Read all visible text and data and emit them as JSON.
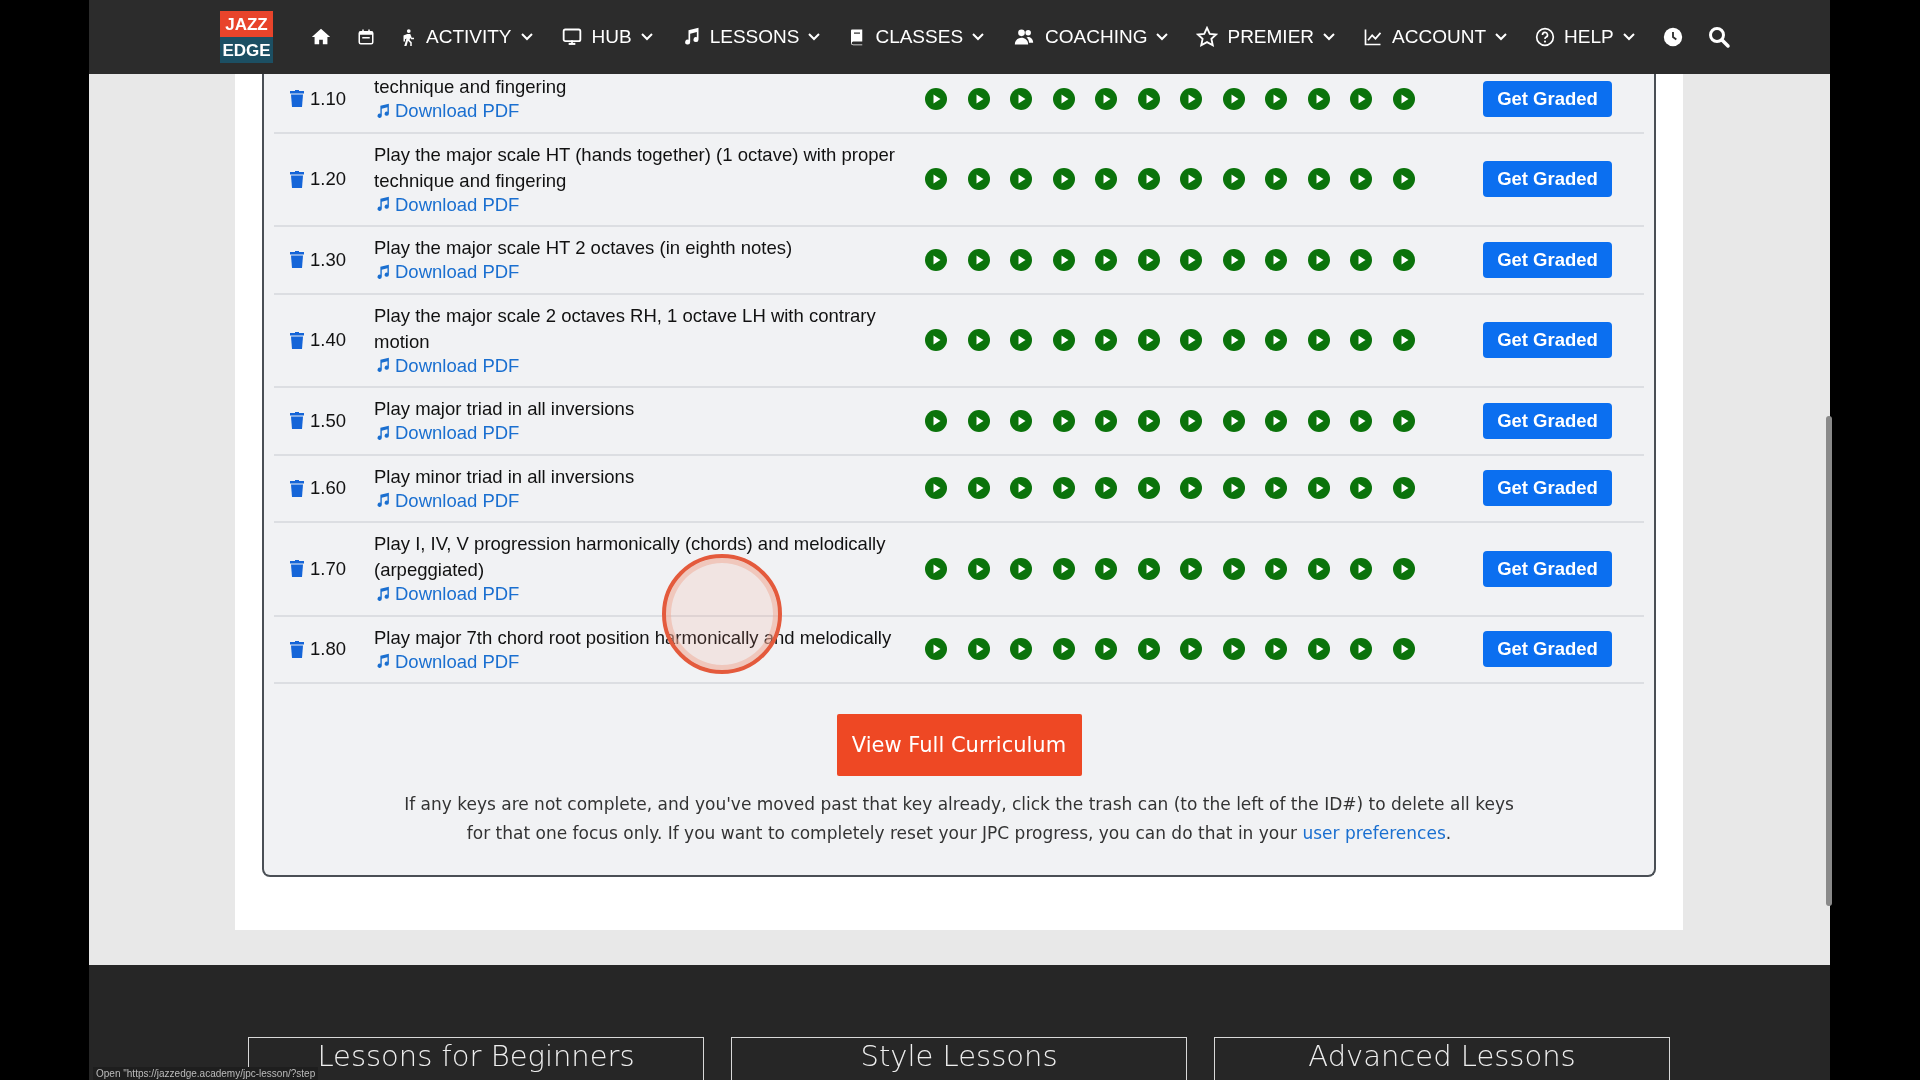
{
  "nav": {
    "items": [
      {
        "kind": "home"
      },
      {
        "kind": "calendar"
      },
      {
        "kind": "activity",
        "label": "ACTIVITY"
      },
      {
        "kind": "hub",
        "label": "HUB"
      },
      {
        "kind": "lessons",
        "label": "LESSONS"
      },
      {
        "kind": "classes",
        "label": "CLASSES"
      },
      {
        "kind": "coaching",
        "label": "COACHING"
      },
      {
        "kind": "premier",
        "label": "PREMIER"
      },
      {
        "kind": "account",
        "label": "ACCOUNT"
      },
      {
        "kind": "help",
        "label": "HELP"
      },
      {
        "kind": "history"
      },
      {
        "kind": "search"
      }
    ],
    "logo": {
      "top": "JAZZ",
      "bottom": "EDGE"
    }
  },
  "curriculum": {
    "rows": [
      {
        "id": "1.10",
        "description": "technique and fingering",
        "download": "Download PDF",
        "keys": [
          {
            "kind": "play"
          },
          {
            "kind": "play"
          },
          {
            "kind": "play"
          },
          {
            "kind": "play"
          },
          {
            "kind": "play"
          },
          {
            "kind": "play"
          },
          {
            "kind": "play"
          },
          {
            "kind": "play"
          },
          {
            "kind": "play"
          },
          {
            "kind": "play"
          },
          {
            "kind": "play"
          },
          {
            "kind": "play"
          }
        ],
        "button": "Get Graded"
      },
      {
        "id": "1.20",
        "description": "Play the major scale HT (hands together) (1 octave) with proper technique and fingering",
        "download": "Download PDF",
        "keys": [
          {
            "kind": "play"
          },
          {
            "kind": "play"
          },
          {
            "kind": "play"
          },
          {
            "kind": "play"
          },
          {
            "kind": "play"
          },
          {
            "kind": "play"
          },
          {
            "kind": "play"
          },
          {
            "kind": "play"
          },
          {
            "kind": "play"
          },
          {
            "kind": "play"
          },
          {
            "kind": "play"
          },
          {
            "kind": "play"
          }
        ],
        "button": "Get Graded"
      },
      {
        "id": "1.30",
        "description": "Play the major scale HT 2 octaves (in eighth notes)",
        "download": "Download PDF",
        "keys": [
          {
            "kind": "play"
          },
          {
            "kind": "play"
          },
          {
            "kind": "play"
          },
          {
            "kind": "play"
          },
          {
            "kind": "play"
          },
          {
            "kind": "play"
          },
          {
            "kind": "play"
          },
          {
            "kind": "play"
          },
          {
            "kind": "play"
          },
          {
            "kind": "play"
          },
          {
            "kind": "play"
          },
          {
            "kind": "play"
          }
        ],
        "button": "Get Graded"
      },
      {
        "id": "1.40",
        "description": "Play the major scale 2 octaves RH, 1 octave LH with contrary motion",
        "download": "Download PDF",
        "keys": [
          {
            "kind": "play"
          },
          {
            "kind": "play"
          },
          {
            "kind": "play"
          },
          {
            "kind": "play"
          },
          {
            "kind": "play"
          },
          {
            "kind": "play"
          },
          {
            "kind": "play"
          },
          {
            "kind": "play"
          },
          {
            "kind": "play"
          },
          {
            "kind": "play"
          },
          {
            "kind": "play"
          },
          {
            "kind": "play"
          }
        ],
        "button": "Get Graded"
      },
      {
        "id": "1.50",
        "description": "Play major triad in all inversions",
        "download": "Download PDF",
        "keys": [
          {
            "kind": "play"
          },
          {
            "kind": "play"
          },
          {
            "kind": "play"
          },
          {
            "kind": "play"
          },
          {
            "kind": "play"
          },
          {
            "kind": "play"
          },
          {
            "kind": "play"
          },
          {
            "kind": "play"
          },
          {
            "kind": "play"
          },
          {
            "kind": "play"
          },
          {
            "kind": "play"
          },
          {
            "kind": "play"
          }
        ],
        "button": "Get Graded"
      },
      {
        "id": "1.60",
        "description": "Play minor triad in all inversions",
        "download": "Download PDF",
        "keys": [
          {
            "kind": "play"
          },
          {
            "kind": "play"
          },
          {
            "kind": "play"
          },
          {
            "kind": "play"
          },
          {
            "kind": "play"
          },
          {
            "kind": "play"
          },
          {
            "kind": "play"
          },
          {
            "kind": "play"
          },
          {
            "kind": "play"
          },
          {
            "kind": "play"
          },
          {
            "kind": "play"
          },
          {
            "kind": "play"
          }
        ],
        "button": "Get Graded"
      },
      {
        "id": "1.70",
        "description": "Play I, IV, V progression harmonically (chords) and melodically (arpeggiated)",
        "download": "Download PDF",
        "keys": [
          {
            "kind": "play"
          },
          {
            "kind": "play"
          },
          {
            "kind": "play"
          },
          {
            "kind": "play"
          },
          {
            "kind": "play"
          },
          {
            "kind": "play"
          },
          {
            "kind": "play"
          },
          {
            "kind": "play"
          },
          {
            "kind": "play"
          },
          {
            "kind": "play"
          },
          {
            "kind": "play"
          },
          {
            "kind": "play"
          }
        ],
        "button": "Get Graded"
      },
      {
        "id": "1.80",
        "description": "Play major 7th chord root position harmonically and melodically",
        "download": "Download PDF",
        "keys": [
          {
            "kind": "play"
          },
          {
            "kind": "play"
          },
          {
            "kind": "play"
          },
          {
            "kind": "play"
          },
          {
            "kind": "play"
          },
          {
            "kind": "play"
          },
          {
            "kind": "play"
          },
          {
            "kind": "play"
          },
          {
            "kind": "play"
          },
          {
            "kind": "play"
          },
          {
            "kind": "play"
          },
          {
            "kind": "play"
          }
        ],
        "button": "Get Graded"
      }
    ],
    "cta": "View Full Curriculum",
    "note": "If any keys are not complete, and you've moved past that key already, click the trash can (to the left of the ID#) to delete all keys for that one focus only. If you want to completely reset your JPC progress, you can do that in your ",
    "note_link": "user preferences",
    "note_end": "."
  },
  "footer": {
    "boxes": [
      "Lessons for Beginners",
      "Style Lessons",
      "Advanced Lessons"
    ]
  },
  "status_bar": "Open \"https://jazzedge.academy/jpc-lesson/?step"
}
